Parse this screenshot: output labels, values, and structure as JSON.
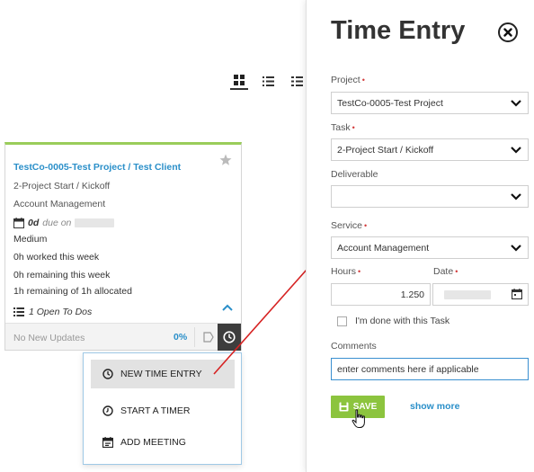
{
  "card": {
    "title": "TestCo-0005-Test Project / Test Client",
    "task": "2-Project Start / Kickoff",
    "service": "Account Management",
    "due_days": "0d",
    "due_on": "due on",
    "priority": "Medium",
    "worked": "0h worked this week",
    "remaining_week": "0h remaining this week",
    "remaining_alloc": "1h remaining of 1h allocated",
    "todos": "1 Open To Dos",
    "no_updates": "No New Updates",
    "percent": "0%"
  },
  "menu": {
    "items": [
      {
        "label": "NEW TIME ENTRY",
        "icon": "clock-icon"
      },
      {
        "label": "START A TIMER",
        "icon": "timer-icon"
      },
      {
        "label": "ADD MEETING",
        "icon": "calendar-icon"
      }
    ]
  },
  "panel": {
    "title": "Time Entry",
    "project_label": "Project",
    "project_value": "TestCo-0005-Test Project",
    "task_label": "Task",
    "task_value": "2-Project Start / Kickoff",
    "deliverable_label": "Deliverable",
    "deliverable_value": "",
    "service_label": "Service",
    "service_value": "Account Management",
    "hours_label": "Hours",
    "hours_value": "1.250",
    "date_label": "Date",
    "done_label": "I'm done with this Task",
    "comments_label": "Comments",
    "comments_value": "enter comments here if applicable",
    "save_label": "SAVE",
    "show_more": "show more",
    "required_mark": "•"
  },
  "colors": {
    "link_blue": "#2a8fc9",
    "save_green": "#8cc43e",
    "required_red": "#d23a3a",
    "card_accent": "#9acd5a",
    "annotation_arrow": "#d62222"
  }
}
